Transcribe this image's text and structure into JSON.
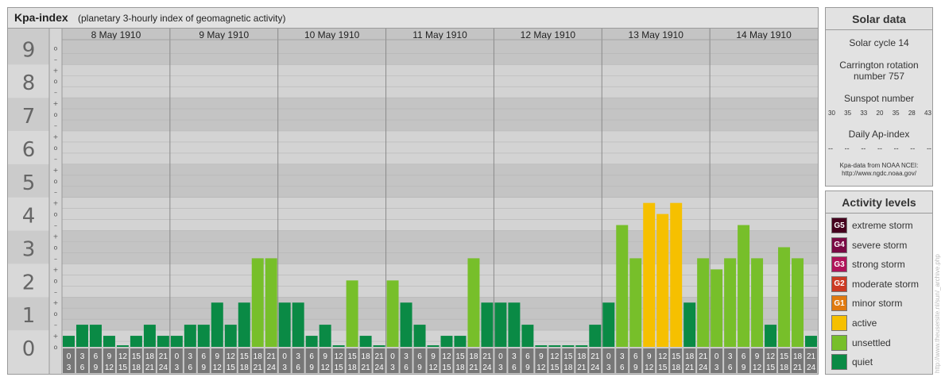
{
  "header": {
    "title": "Kpa-index",
    "subtitle": "(planetary 3-hourly index of geomagnetic activity)"
  },
  "chart_data": {
    "type": "bar",
    "ylim": [
      0,
      9
    ],
    "y_ticks": [
      "0",
      "1",
      "2",
      "3",
      "4",
      "5",
      "6",
      "7",
      "8",
      "9"
    ],
    "minor_tick_labels": [
      "+",
      "o",
      "–"
    ],
    "days": [
      "8 May 1910",
      "9 May 1910",
      "10 May 1910",
      "11 May 1910",
      "12 May 1910",
      "13 May 1910",
      "14 May 1910"
    ],
    "interval_labels_top": [
      "0",
      "3",
      "6",
      "9",
      "12",
      "15",
      "18",
      "21"
    ],
    "interval_labels_bottom": [
      "3",
      "6",
      "9",
      "12",
      "15",
      "18",
      "21",
      "24"
    ],
    "values": [
      [
        0.333,
        0.667,
        0.667,
        0.333,
        0,
        0.333,
        0.667,
        0.333
      ],
      [
        0.333,
        0.667,
        0.667,
        1.333,
        0.667,
        1.333,
        2.667,
        2.667
      ],
      [
        1.333,
        1.333,
        0.333,
        0.667,
        0,
        2,
        0.333,
        0
      ],
      [
        2,
        1.333,
        0.667,
        0,
        0.333,
        0.333,
        2.667,
        1.333
      ],
      [
        1.333,
        1.333,
        0.667,
        0,
        0,
        0,
        0,
        0.667
      ],
      [
        1.333,
        3.667,
        2.667,
        4.333,
        4,
        4.333,
        1.333,
        2.667
      ],
      [
        2.333,
        2.667,
        3.667,
        2.667,
        0.667,
        3,
        2.667,
        0.333
      ]
    ],
    "colors": {
      "quiet": "#0a8a45",
      "unsettled": "#77bf2a",
      "active": "#f6c000",
      "minor_storm": "#e07a10",
      "moderate_storm": "#cc3a22",
      "strong_storm": "#b0135a",
      "severe_storm": "#7a0a45",
      "extreme_storm": "#45001e"
    }
  },
  "solar": {
    "title": "Solar data",
    "cycle": "Solar cycle 14",
    "carrington_line1": "Carrington rotation",
    "carrington_line2": "number 757",
    "sunspot_title": "Sunspot number",
    "sunspot_values": [
      "30",
      "35",
      "33",
      "20",
      "35",
      "28",
      "43"
    ],
    "ap_title": "Daily Ap-index",
    "ap_values": [
      "--",
      "--",
      "--",
      "--",
      "--",
      "--",
      "--"
    ],
    "credit_line1": "Kpa-data from NOAA NCEI:",
    "credit_line2": "http://www.ngdc.noaa.gov/"
  },
  "activity": {
    "title": "Activity levels",
    "items": [
      {
        "code": "G5",
        "label": "extreme storm",
        "color": "#45001e"
      },
      {
        "code": "G4",
        "label": "severe storm",
        "color": "#7a0a45"
      },
      {
        "code": "G3",
        "label": "strong storm",
        "color": "#b0135a"
      },
      {
        "code": "G2",
        "label": "moderate storm",
        "color": "#cc3a22"
      },
      {
        "code": "G1",
        "label": "minor storm",
        "color": "#e07a10"
      },
      {
        "code": "",
        "label": "active",
        "color": "#f6c000"
      },
      {
        "code": "",
        "label": "unsettled",
        "color": "#77bf2a"
      },
      {
        "code": "",
        "label": "quiet",
        "color": "#0a8a45"
      }
    ]
  },
  "watermark": "http://www.theusersite.nl/sun/_archive.php"
}
